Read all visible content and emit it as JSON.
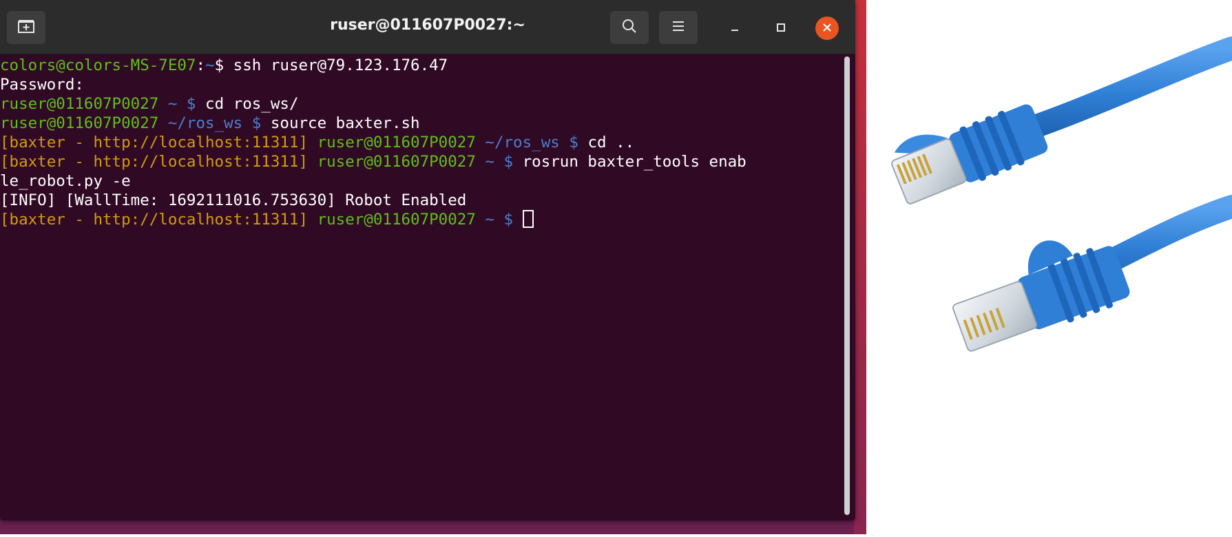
{
  "window": {
    "title": "ruser@011607P0027:~"
  },
  "terminal": {
    "lines": [
      [
        {
          "t": "colors@colors-MS-7E07",
          "c": "green"
        },
        {
          "t": ":",
          "c": "white"
        },
        {
          "t": "~",
          "c": "blue"
        },
        {
          "t": "$ ssh ruser@79.123.176.47",
          "c": "white"
        }
      ],
      [
        {
          "t": "Password:",
          "c": "white"
        }
      ],
      [
        {
          "t": "ruser@011607P0027",
          "c": "green"
        },
        {
          "t": " ~ $ ",
          "c": "blue"
        },
        {
          "t": "cd ros_ws/",
          "c": "white"
        }
      ],
      [
        {
          "t": "ruser@011607P0027",
          "c": "green"
        },
        {
          "t": " ~/ros_ws $ ",
          "c": "blue"
        },
        {
          "t": "source baxter.sh",
          "c": "white"
        }
      ],
      [
        {
          "t": "[baxter - http://localhost:11311] ",
          "c": "orange"
        },
        {
          "t": "ruser@011607P0027",
          "c": "green"
        },
        {
          "t": " ~/ros_ws $ ",
          "c": "blue"
        },
        {
          "t": "cd ..",
          "c": "white"
        }
      ],
      [
        {
          "t": "[baxter - http://localhost:11311] ",
          "c": "orange"
        },
        {
          "t": "ruser@011607P0027",
          "c": "green"
        },
        {
          "t": " ~ $ ",
          "c": "blue"
        },
        {
          "t": "rosrun baxter_tools enab",
          "c": "white"
        }
      ],
      [
        {
          "t": "le_robot.py -e",
          "c": "white"
        }
      ],
      [
        {
          "t": "[INFO] [WallTime: 1692111016.753630] Robot Enabled",
          "c": "white"
        }
      ],
      [
        {
          "t": "[baxter - http://localhost:11311] ",
          "c": "orange"
        },
        {
          "t": "ruser@011607P0027",
          "c": "green"
        },
        {
          "t": " ~ $ ",
          "c": "blue"
        }
      ]
    ]
  },
  "colors": {
    "terminal_bg": "#300a24",
    "titlebar_bg": "#2c2c2c",
    "close_button": "#e95420",
    "prompt_green": "#5fbf1a",
    "prompt_blue": "#4a7fd0",
    "env_orange": "#d29b0b",
    "cable_blue": "#2f7fd6"
  },
  "icons": {
    "new_tab": "new-tab-icon",
    "search": "search-icon",
    "menu": "hamburger-menu-icon",
    "minimize": "minimize-icon",
    "maximize": "maximize-icon",
    "close": "close-icon"
  }
}
